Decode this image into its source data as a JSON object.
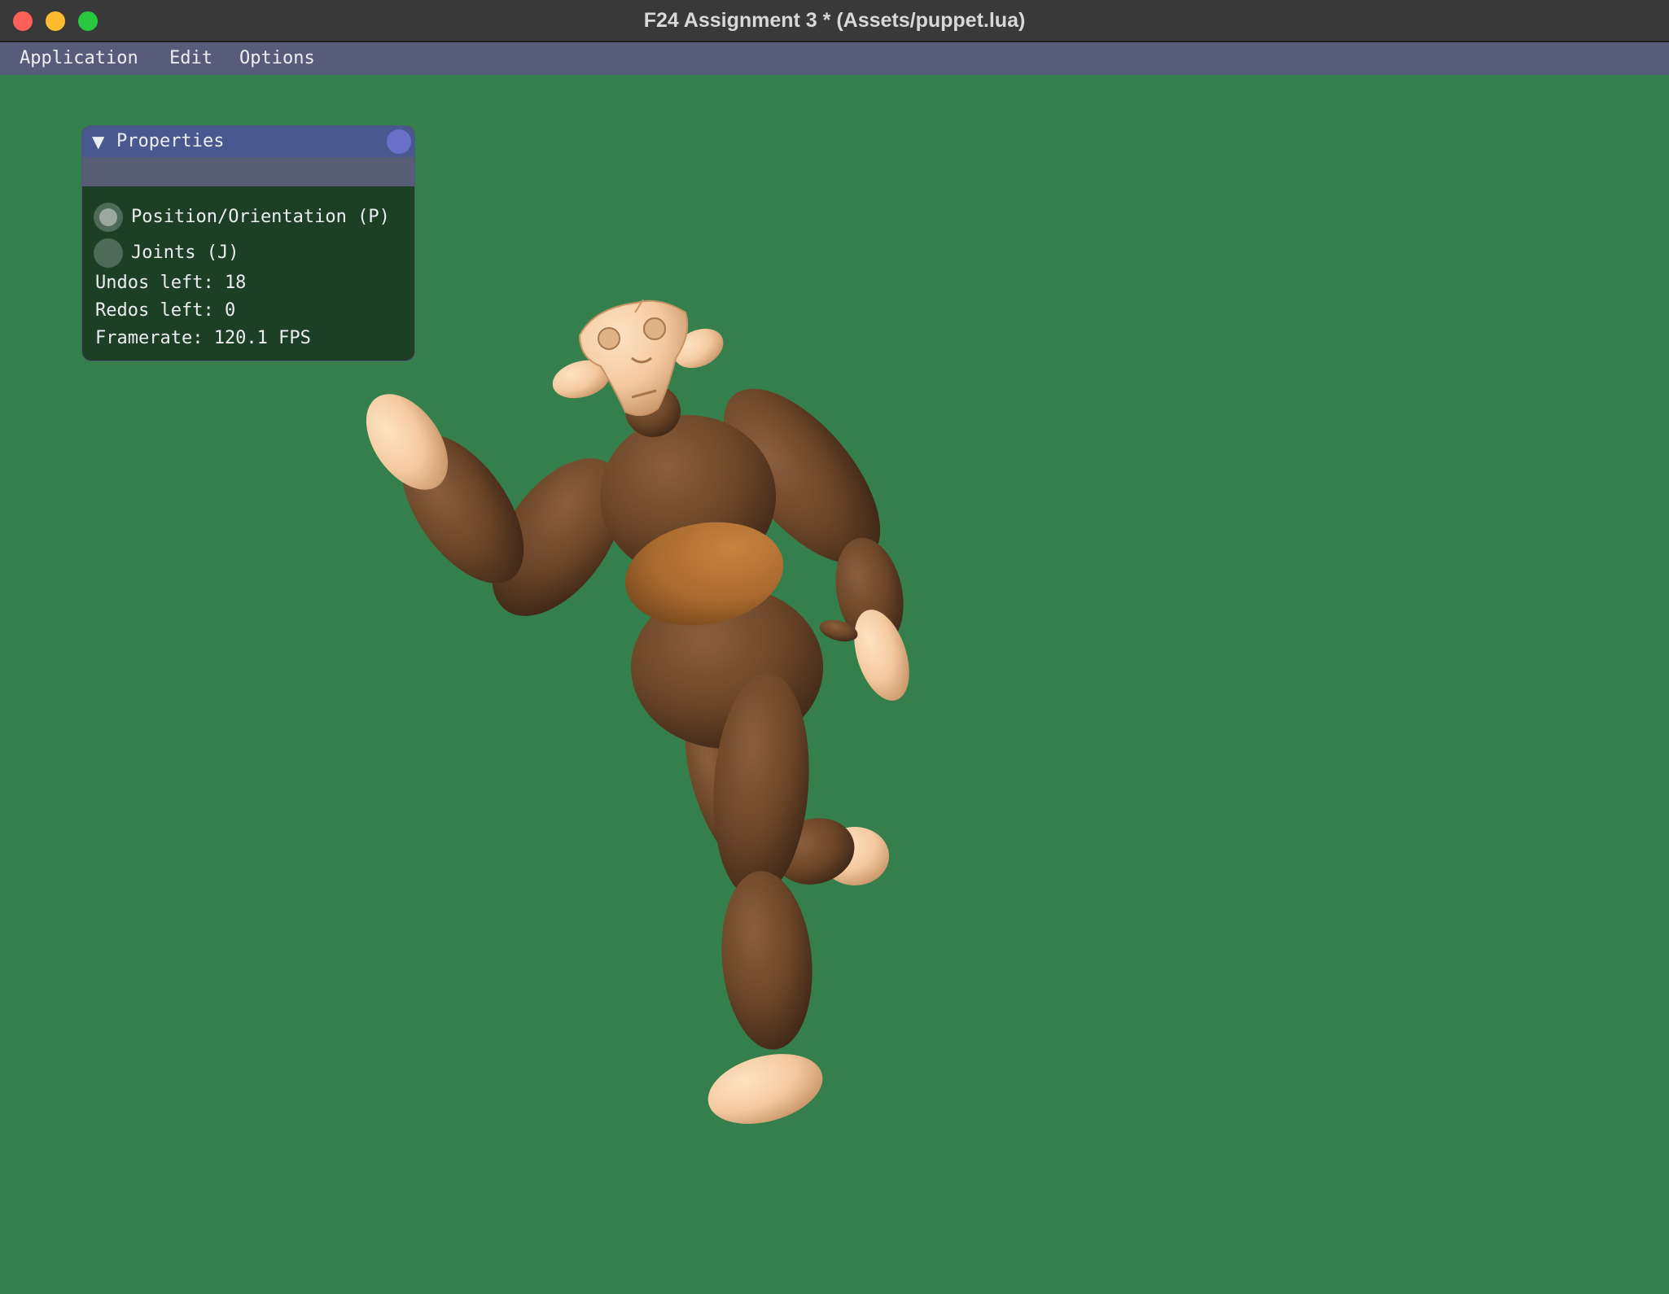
{
  "window": {
    "title": "F24 Assignment 3 * (Assets/puppet.lua)"
  },
  "menubar": {
    "items": [
      {
        "label": "Application"
      },
      {
        "label": "Edit"
      },
      {
        "label": "Options"
      }
    ]
  },
  "properties_panel": {
    "title": "Properties",
    "modes": [
      {
        "label": "Position/Orientation (P)",
        "selected": true
      },
      {
        "label": "Joints (J)",
        "selected": false
      }
    ],
    "undos": "Undos left: 18",
    "redos": "Redos left: 0",
    "framerate": "Framerate: 120.1 FPS"
  },
  "colors": {
    "background": "#357f4c",
    "titlebar": "#393939",
    "menubar": "#575c7a",
    "panel_header": "#49598f",
    "panel_body": "#1c3f26",
    "fur": "#6f4a30",
    "skin": "#f4c9a0",
    "belt": "#b27233"
  },
  "icons": {
    "collapse": "triangle-down-icon",
    "close": "close-circle-icon"
  }
}
